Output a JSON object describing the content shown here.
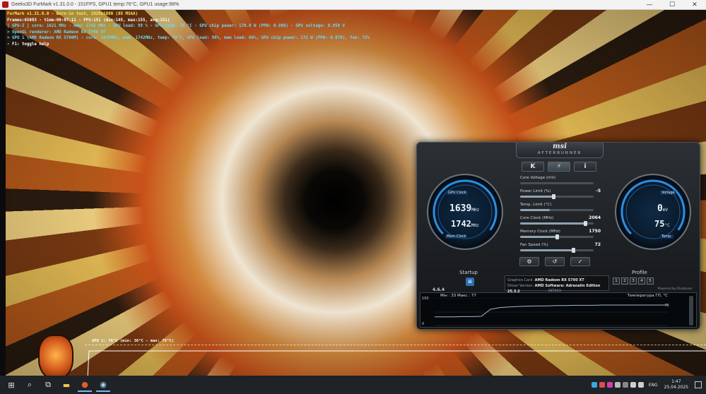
{
  "window": {
    "title": "Geeks3D FurMark v1.31.0.0 - 151FPS, GPU1 temp:76°C, GPU1 usage:98%",
    "min": "—",
    "max": "☐",
    "close": "✕"
  },
  "furmark": {
    "overlay_lines": [
      "FurMark v1.31.0.0 - Burn-in test, 1920x1080 (8X MSAA)",
      "Frames:65093 - time:00:07:11 - FPS:151 (min:145, max:155, avg:151)",
      "[ GPU-Z ] core: 1621 MHz - mem: 1742 MHz - GPU load: 99 % - GPU temp: 76 °C - GPU chip power: 170.0 W (PPW: 0.888) - GPU voltage: 0.950 V",
      "> OpenGL renderer: AMD Radeon RX 5700 XT",
      "> GPU 1 (AMD Radeon RX 5700M) - core: 1635MHz, mem: 1742MHz, temp: 76°C, GPU load: 98%, mem load: 60%, GPU chip power: 172 W (PPW: 0.878), fan: 72%",
      "- F1: toggle help"
    ],
    "graph_label": "GPU 1: 76°C (min: 36°C - max: 76°C)"
  },
  "afterburner": {
    "brand": "msi",
    "subtitle": "AFTERBURNER",
    "tabs": [
      "K",
      "⚡",
      "i"
    ],
    "left_gauge": {
      "label_top": "GPU Clock",
      "label_bottom": "Mem Clock",
      "gpu_clock_value": "1639",
      "gpu_clock_unit": "MHz",
      "mem_clock_value": "1742",
      "mem_clock_unit": "MHz"
    },
    "right_gauge": {
      "label_top": "Voltage",
      "label_bottom": "Temp.",
      "voltage_value": "0",
      "voltage_unit": "mV",
      "temp_value": "75",
      "temp_unit": "°C"
    },
    "sliders": [
      {
        "label": "Core Voltage (mV)",
        "value": "",
        "fill": 0
      },
      {
        "label": "Power Limit (%)",
        "value": "-5",
        "fill": 0.45
      },
      {
        "label": "Temp. Limit (°C)",
        "value": "",
        "fill": 0.4
      },
      {
        "label": "Core Clock (MHz)",
        "value": "2064",
        "fill": 0.88
      },
      {
        "label": "Memory Clock (MHz)",
        "value": "1750",
        "fill": 0.5
      },
      {
        "label": "Fan Speed (%)",
        "value": "72",
        "fill": 0.72
      }
    ],
    "actions": [
      "⚙",
      "↺",
      "✓"
    ],
    "startup_label": "Startup",
    "profile_label": "Profile",
    "profile_slots": [
      "1",
      "2",
      "3",
      "4",
      "5"
    ],
    "graphics_card_label": "Graphics Card:",
    "graphics_card": "AMD Radeon RX 5700 XT",
    "driver_label": "Driver Version:",
    "driver": "AMD Software: Adrenalin Edition 25.3.2",
    "detach": "DETACH",
    "version": "4.6.4",
    "powered_by": "Powered by Rivatuner",
    "monitor": {
      "min_label": "Мін : 33",
      "max_label": "Макс : 77",
      "title": "Температура ГП, °C",
      "y_top": "100",
      "y_bottom": "0",
      "right_value": "75",
      "series": [
        33,
        33,
        33,
        34,
        34,
        35,
        60,
        66,
        68,
        70,
        71,
        72,
        72,
        73,
        73,
        74,
        74,
        74,
        75,
        75,
        75,
        75,
        75,
        75,
        75,
        75
      ]
    }
  },
  "taskbar": {
    "icons": [
      "start-icon",
      "search-icon",
      "task-view-icon",
      "file-explorer-icon",
      "furmark-icon",
      "afterburner-icon"
    ],
    "language": "ENG",
    "time": "1:47",
    "date": "25.04.2025"
  }
}
